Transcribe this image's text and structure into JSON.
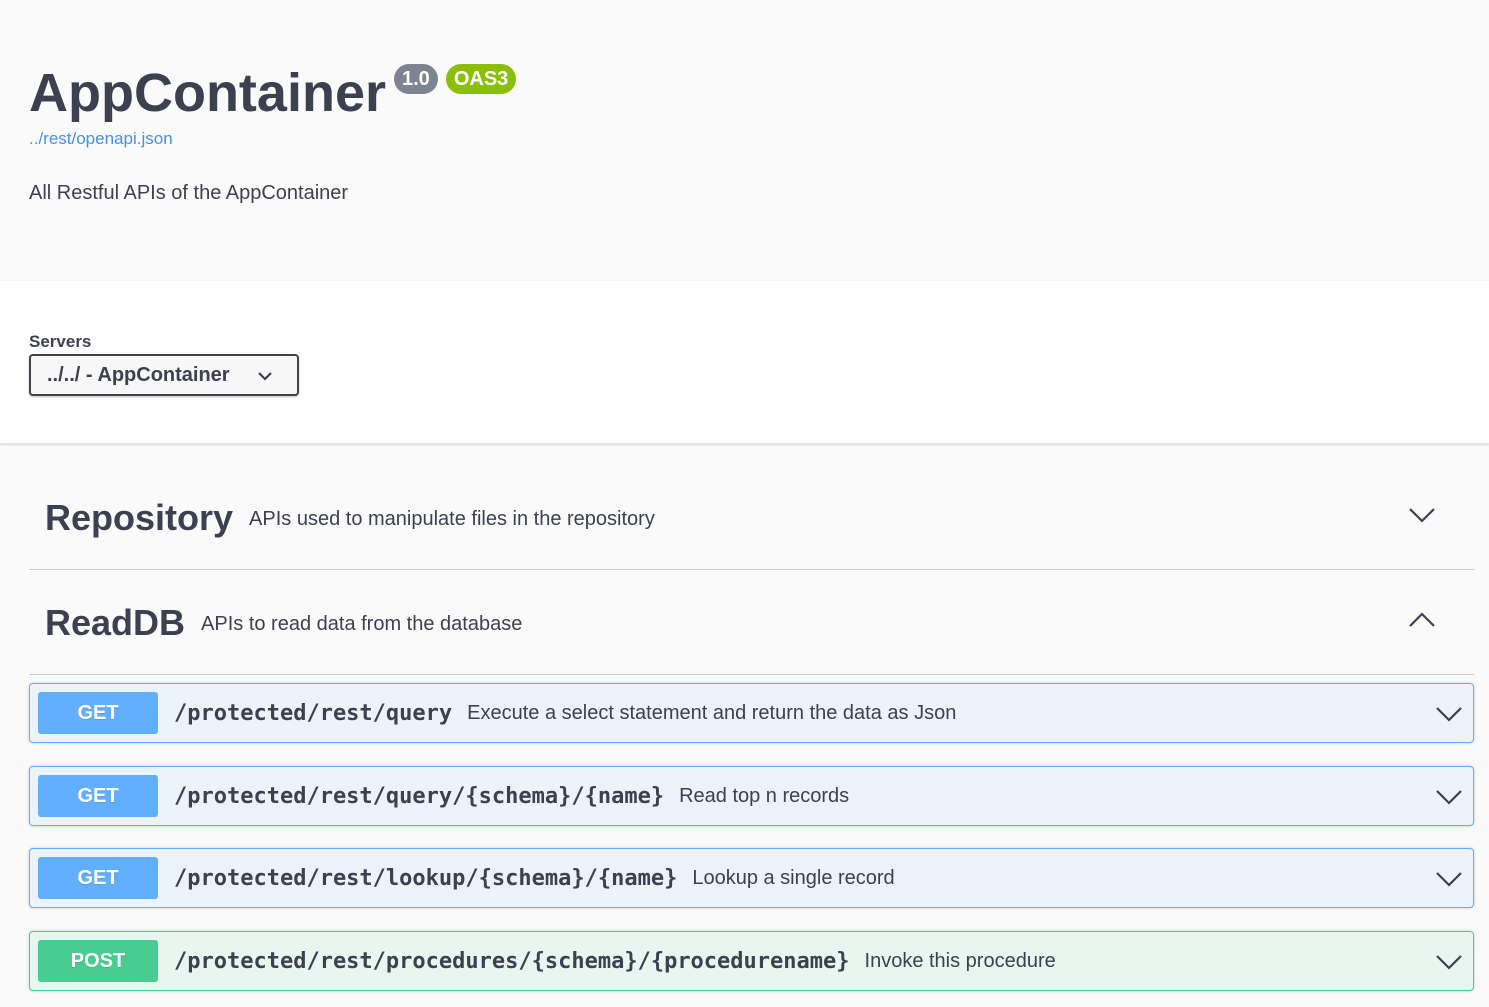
{
  "info": {
    "title": "AppContainer",
    "version": "1.0",
    "oas_badge": "OAS3",
    "spec_url": "../rest/openapi.json",
    "description": "All Restful APIs of the AppContainer"
  },
  "servers": {
    "label": "Servers",
    "selected": "../../ - AppContainer"
  },
  "tags": [
    {
      "name": "Repository",
      "description": "APIs used to manipulate files in the repository",
      "expanded": false
    },
    {
      "name": "ReadDB",
      "description": "APIs to read data from the database",
      "expanded": true
    }
  ],
  "operations": [
    {
      "method": "GET",
      "path": "/protected/rest/query",
      "summary": "Execute a select statement and return the data as Json"
    },
    {
      "method": "GET",
      "path": "/protected/rest/query/{schema}/{name}",
      "summary": "Read top n records"
    },
    {
      "method": "GET",
      "path": "/protected/rest/lookup/{schema}/{name}",
      "summary": "Lookup a single record"
    },
    {
      "method": "POST",
      "path": "/protected/rest/procedures/{schema}/{procedurename}",
      "summary": "Invoke this procedure"
    }
  ],
  "colors": {
    "get": "#61affe",
    "post": "#49cc90",
    "version_badge": "#7d8492",
    "oas_badge": "#89bf04",
    "link": "#4990e2"
  }
}
